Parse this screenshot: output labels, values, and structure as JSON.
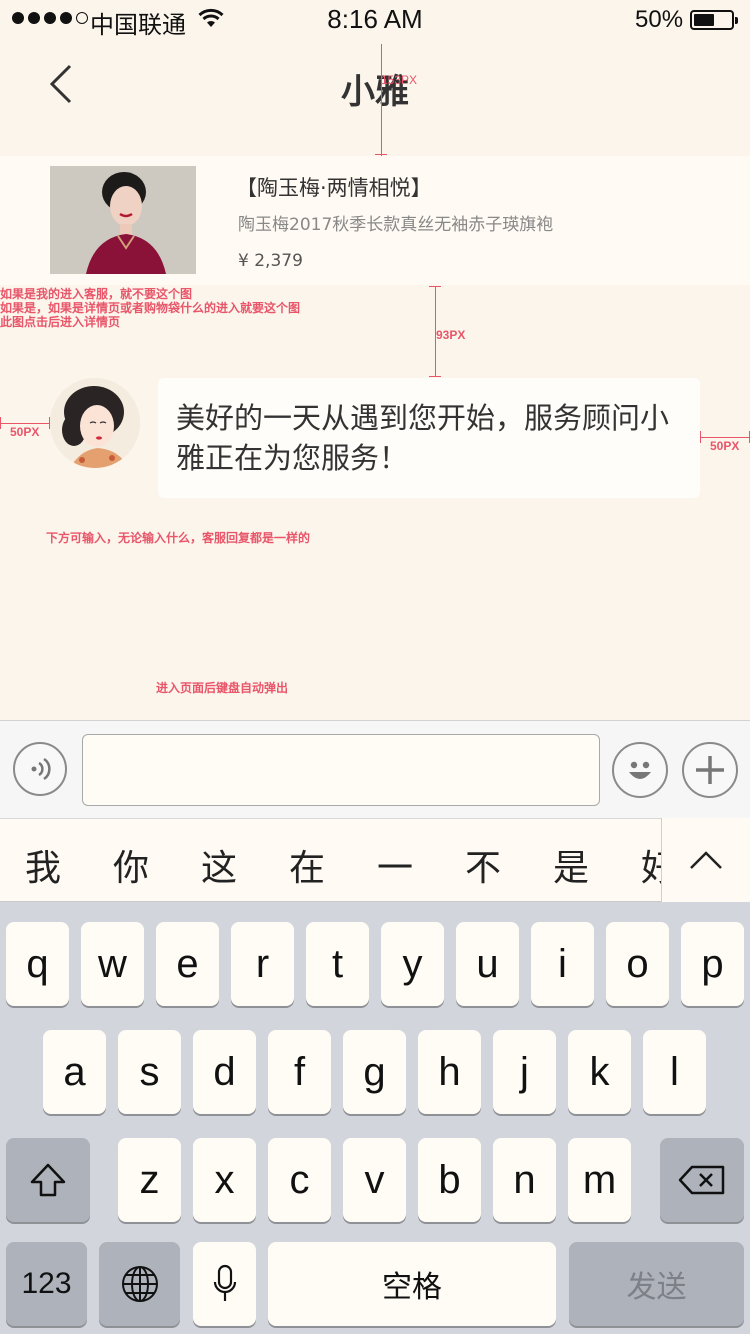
{
  "status_bar": {
    "carrier": "中国联通",
    "time": "8:16 AM",
    "battery": "50%",
    "battery_level": 0.5
  },
  "nav": {
    "title": "小雅"
  },
  "annotations": {
    "top_gap": "153PX",
    "card_gap": "93PX",
    "left_margin": "50PX",
    "right_margin": "50PX",
    "card_note_1": "如果是我的进入客服，就不要这个图",
    "card_note_2": "如果是，如果是详情页或者购物袋什么的进入就要这个图",
    "card_note_3": "此图点击后进入详情页",
    "input_note": "下方可输入，无论输入什么，客服回复都是一样的",
    "keyboard_note": "进入页面后键盘自动弹出"
  },
  "product": {
    "name": "【陶玉梅·两情相悦】",
    "description": "陶玉梅2017秋季长款真丝无袖赤子瑛旗袍",
    "price": "¥ 2,379"
  },
  "chat": {
    "message": "美好的一天从遇到您开始，服务顾问小雅正在为您服务！"
  },
  "candidates": [
    "我",
    "你",
    "这",
    "在",
    "一",
    "不",
    "是",
    "好"
  ],
  "keyboard": {
    "row1": [
      "q",
      "w",
      "e",
      "r",
      "t",
      "y",
      "u",
      "i",
      "o",
      "p"
    ],
    "row2": [
      "a",
      "s",
      "d",
      "f",
      "g",
      "h",
      "j",
      "k",
      "l"
    ],
    "row3": [
      "z",
      "x",
      "c",
      "v",
      "b",
      "n",
      "m"
    ],
    "numbers": "123",
    "space": "空格",
    "send": "发送"
  }
}
